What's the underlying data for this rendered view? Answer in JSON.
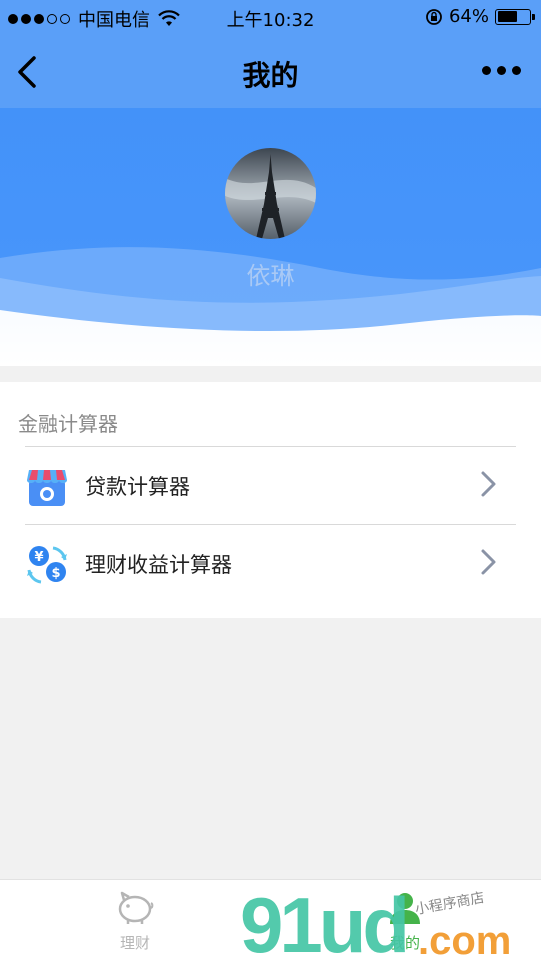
{
  "status_bar": {
    "carrier": "中国电信",
    "time": "上午10:32",
    "battery_percent": "64%",
    "battery_level": 0.64,
    "signal_bars_on": 3,
    "signal_bars_total": 5
  },
  "nav": {
    "title": "我的",
    "back_icon": "chevron-left-icon",
    "more_icon": "more-dots-icon"
  },
  "profile": {
    "avatar_image": "eiffel-tower-photo",
    "name": "依琳"
  },
  "section": {
    "title": "金融计算器",
    "items": [
      {
        "label": "贷款计算器",
        "icon": "shop-icon"
      },
      {
        "label": "理财收益计算器",
        "icon": "currency-exchange-icon"
      }
    ]
  },
  "tabs": [
    {
      "label": "理财",
      "icon": "piggy-bank-icon",
      "active": false
    },
    {
      "label": "我的",
      "icon": "user-icon",
      "active": true
    }
  ],
  "watermark": {
    "logo_text": "91ud.com",
    "tagline": "小程序商店"
  },
  "colors": {
    "header_blue": "#5a9ff8",
    "profile_blue": "#4392f9",
    "active_tab": "#45b34a",
    "inactive_tab": "#b5b5b5"
  }
}
